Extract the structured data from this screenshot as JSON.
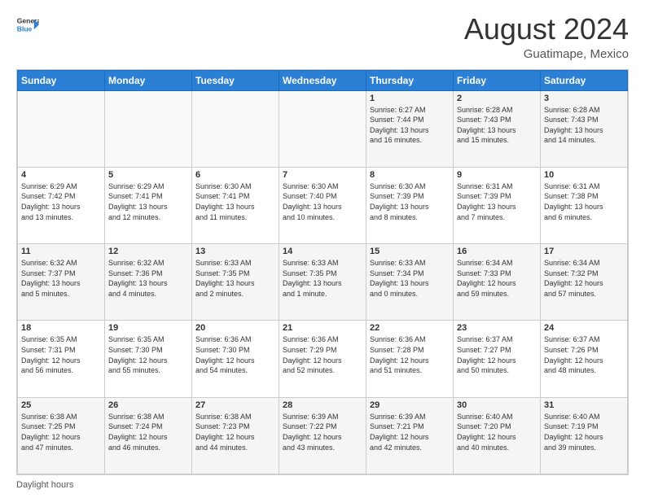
{
  "logo": {
    "line1": "General",
    "line2": "Blue"
  },
  "header": {
    "title": "August 2024",
    "subtitle": "Guatimape, Mexico"
  },
  "columns": [
    "Sunday",
    "Monday",
    "Tuesday",
    "Wednesday",
    "Thursday",
    "Friday",
    "Saturday"
  ],
  "weeks": [
    [
      {
        "day": "",
        "info": ""
      },
      {
        "day": "",
        "info": ""
      },
      {
        "day": "",
        "info": ""
      },
      {
        "day": "",
        "info": ""
      },
      {
        "day": "1",
        "info": "Sunrise: 6:27 AM\nSunset: 7:44 PM\nDaylight: 13 hours\nand 16 minutes."
      },
      {
        "day": "2",
        "info": "Sunrise: 6:28 AM\nSunset: 7:43 PM\nDaylight: 13 hours\nand 15 minutes."
      },
      {
        "day": "3",
        "info": "Sunrise: 6:28 AM\nSunset: 7:43 PM\nDaylight: 13 hours\nand 14 minutes."
      }
    ],
    [
      {
        "day": "4",
        "info": "Sunrise: 6:29 AM\nSunset: 7:42 PM\nDaylight: 13 hours\nand 13 minutes."
      },
      {
        "day": "5",
        "info": "Sunrise: 6:29 AM\nSunset: 7:41 PM\nDaylight: 13 hours\nand 12 minutes."
      },
      {
        "day": "6",
        "info": "Sunrise: 6:30 AM\nSunset: 7:41 PM\nDaylight: 13 hours\nand 11 minutes."
      },
      {
        "day": "7",
        "info": "Sunrise: 6:30 AM\nSunset: 7:40 PM\nDaylight: 13 hours\nand 10 minutes."
      },
      {
        "day": "8",
        "info": "Sunrise: 6:30 AM\nSunset: 7:39 PM\nDaylight: 13 hours\nand 8 minutes."
      },
      {
        "day": "9",
        "info": "Sunrise: 6:31 AM\nSunset: 7:39 PM\nDaylight: 13 hours\nand 7 minutes."
      },
      {
        "day": "10",
        "info": "Sunrise: 6:31 AM\nSunset: 7:38 PM\nDaylight: 13 hours\nand 6 minutes."
      }
    ],
    [
      {
        "day": "11",
        "info": "Sunrise: 6:32 AM\nSunset: 7:37 PM\nDaylight: 13 hours\nand 5 minutes."
      },
      {
        "day": "12",
        "info": "Sunrise: 6:32 AM\nSunset: 7:36 PM\nDaylight: 13 hours\nand 4 minutes."
      },
      {
        "day": "13",
        "info": "Sunrise: 6:33 AM\nSunset: 7:35 PM\nDaylight: 13 hours\nand 2 minutes."
      },
      {
        "day": "14",
        "info": "Sunrise: 6:33 AM\nSunset: 7:35 PM\nDaylight: 13 hours\nand 1 minute."
      },
      {
        "day": "15",
        "info": "Sunrise: 6:33 AM\nSunset: 7:34 PM\nDaylight: 13 hours\nand 0 minutes."
      },
      {
        "day": "16",
        "info": "Sunrise: 6:34 AM\nSunset: 7:33 PM\nDaylight: 12 hours\nand 59 minutes."
      },
      {
        "day": "17",
        "info": "Sunrise: 6:34 AM\nSunset: 7:32 PM\nDaylight: 12 hours\nand 57 minutes."
      }
    ],
    [
      {
        "day": "18",
        "info": "Sunrise: 6:35 AM\nSunset: 7:31 PM\nDaylight: 12 hours\nand 56 minutes."
      },
      {
        "day": "19",
        "info": "Sunrise: 6:35 AM\nSunset: 7:30 PM\nDaylight: 12 hours\nand 55 minutes."
      },
      {
        "day": "20",
        "info": "Sunrise: 6:36 AM\nSunset: 7:30 PM\nDaylight: 12 hours\nand 54 minutes."
      },
      {
        "day": "21",
        "info": "Sunrise: 6:36 AM\nSunset: 7:29 PM\nDaylight: 12 hours\nand 52 minutes."
      },
      {
        "day": "22",
        "info": "Sunrise: 6:36 AM\nSunset: 7:28 PM\nDaylight: 12 hours\nand 51 minutes."
      },
      {
        "day": "23",
        "info": "Sunrise: 6:37 AM\nSunset: 7:27 PM\nDaylight: 12 hours\nand 50 minutes."
      },
      {
        "day": "24",
        "info": "Sunrise: 6:37 AM\nSunset: 7:26 PM\nDaylight: 12 hours\nand 48 minutes."
      }
    ],
    [
      {
        "day": "25",
        "info": "Sunrise: 6:38 AM\nSunset: 7:25 PM\nDaylight: 12 hours\nand 47 minutes."
      },
      {
        "day": "26",
        "info": "Sunrise: 6:38 AM\nSunset: 7:24 PM\nDaylight: 12 hours\nand 46 minutes."
      },
      {
        "day": "27",
        "info": "Sunrise: 6:38 AM\nSunset: 7:23 PM\nDaylight: 12 hours\nand 44 minutes."
      },
      {
        "day": "28",
        "info": "Sunrise: 6:39 AM\nSunset: 7:22 PM\nDaylight: 12 hours\nand 43 minutes."
      },
      {
        "day": "29",
        "info": "Sunrise: 6:39 AM\nSunset: 7:21 PM\nDaylight: 12 hours\nand 42 minutes."
      },
      {
        "day": "30",
        "info": "Sunrise: 6:40 AM\nSunset: 7:20 PM\nDaylight: 12 hours\nand 40 minutes."
      },
      {
        "day": "31",
        "info": "Sunrise: 6:40 AM\nSunset: 7:19 PM\nDaylight: 12 hours\nand 39 minutes."
      }
    ]
  ],
  "footer": {
    "daylight_label": "Daylight hours"
  }
}
